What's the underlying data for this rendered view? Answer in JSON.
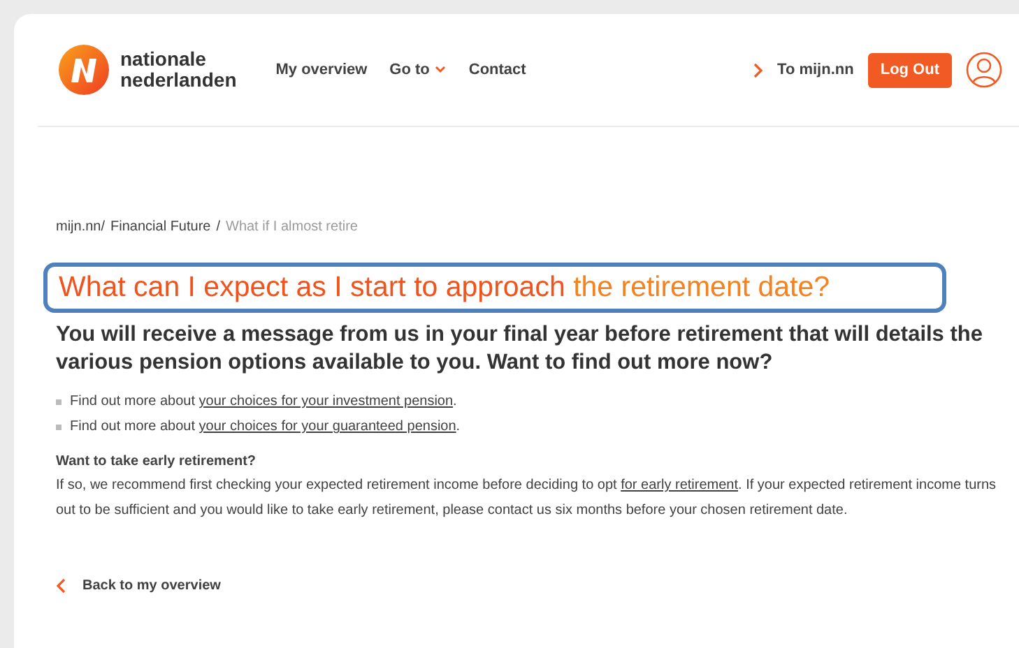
{
  "header": {
    "logo_text": [
      "nationale",
      "nederlanden"
    ],
    "nav": [
      {
        "label": "My overview",
        "dropdown": false
      },
      {
        "label": "Go to",
        "dropdown": true
      },
      {
        "label": "Contact",
        "dropdown": false
      }
    ],
    "portal_link": "To mijn.nn",
    "logout_button": "Log Out"
  },
  "breadcrumb": [
    {
      "label": "mijn.nn/",
      "current": false
    },
    {
      "label": "Financial Future",
      "current": false,
      "separator": "/"
    },
    {
      "label": "What if I almost retire",
      "current": true
    }
  ],
  "heading": {
    "highlighted": true,
    "parts": [
      {
        "text": "What can I expect as I start to approach",
        "color": "#f0541e"
      },
      {
        "text": "the retirement date?",
        "color": "#f58220"
      }
    ]
  },
  "intro": "You will receive a message from us in your final year before retirement that will details the various pension options available to you. Want to find out more now?",
  "bullets": [
    {
      "prefix": "Find out more about ",
      "link": "your choices for your investment pension",
      "suffix": "."
    },
    {
      "prefix": "Find out more about ",
      "link": "your choices for your guaranteed pension",
      "suffix": "."
    }
  ],
  "early_retirement": {
    "title": "Want to take early retirement?",
    "before": "If so, we recommend first checking your expected retirement income before deciding to opt ",
    "link": "for early retirement",
    "after": ". If your expected retirement income turns out to be sufficient and you would like to take early retirement, please contact us six months before your chosen retirement date."
  },
  "back_link": "Back to my overview"
}
